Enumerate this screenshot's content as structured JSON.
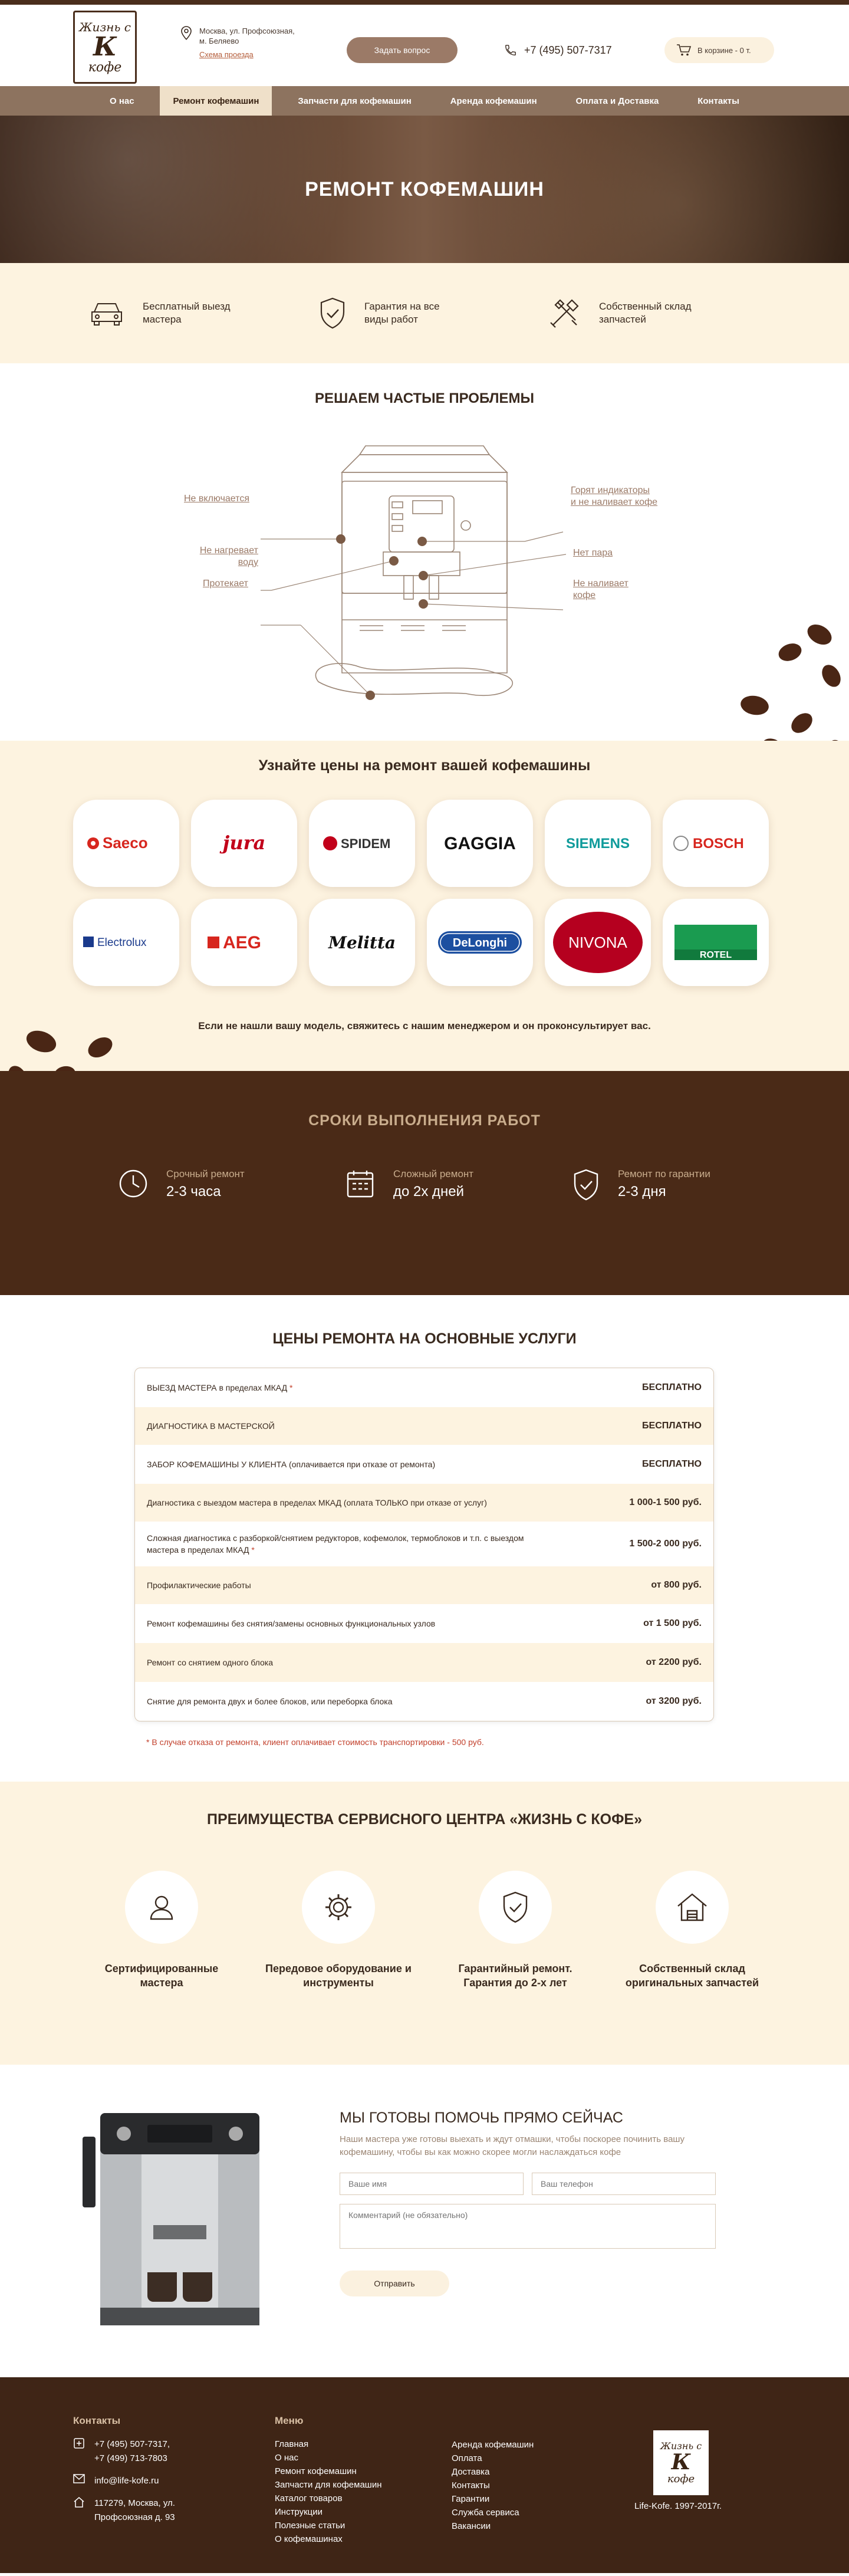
{
  "header": {
    "logo": {
      "line1": "Жизнь с",
      "line2": "К",
      "line3": "кофе"
    },
    "address": [
      "Москва, ул. Профсоюзная,",
      "м. Беляево"
    ],
    "map_link": "Схема проезда",
    "ask_button": "Задать вопрос",
    "phone": "+7 (495) 507-7317",
    "cart": "В корзине - 0 т."
  },
  "nav": [
    "О нас",
    "Ремонт кофемашин",
    "Запчасти для кофемашин",
    "Аренда кофемашин",
    "Оплата и Доставка",
    "Контакты"
  ],
  "hero": {
    "title": "РЕМОНТ КОФЕМАШИН"
  },
  "features": [
    {
      "icon": "car-icon",
      "line1": "Бесплатный выезд",
      "line2": "мастера"
    },
    {
      "icon": "shield-check-icon",
      "line1": "Гарантия на все",
      "line2": "виды работ"
    },
    {
      "icon": "tools-icon",
      "line1": "Собственный склад",
      "line2": "запчастей"
    }
  ],
  "problems": {
    "title": "РЕШАЕМ ЧАСТЫЕ ПРОБЛЕМЫ",
    "left": [
      {
        "line1": "Не включается",
        "line2": ""
      },
      {
        "line1": "Не нагревает",
        "line2": "воду"
      },
      {
        "line1": "Протекает",
        "line2": ""
      }
    ],
    "right": [
      {
        "line1": "Горят индикаторы",
        "line2": "и не наливает кофе"
      },
      {
        "line1": "Нет пара",
        "line2": ""
      },
      {
        "line1": "Не наливает",
        "line2": "кофе"
      }
    ]
  },
  "brands": {
    "title": "Узнайте цены на ремонт вашей кофемашины",
    "items": [
      "Saeco",
      "jura",
      "SPIDEM",
      "GAGGIA",
      "SIEMENS",
      "BOSCH",
      "Electrolux",
      "AEG",
      "Melitta",
      "DeLonghi",
      "NIVONA",
      "ROTEL"
    ],
    "note": "Если не нашли вашу модель, свяжитесь с нашим менеджером и он проконсультирует вас."
  },
  "terms": {
    "title": "СРОКИ ВЫПОЛНЕНИЯ РАБОТ",
    "items": [
      {
        "icon": "clock-icon",
        "label": "Срочный ремонт",
        "value": "2-3 часа"
      },
      {
        "icon": "calendar-icon",
        "label": "Сложный ремонт",
        "value": "до 2х дней"
      },
      {
        "icon": "shield-check-icon",
        "label": "Ремонт по гарантии",
        "value": "2-3 дня"
      }
    ]
  },
  "prices": {
    "title": "ЦЕНЫ РЕМОНТА НА ОСНОВНЫЕ УСЛУГИ",
    "rows": [
      {
        "service": "ВЫЕЗД МАСТЕРА в пределах МКАД",
        "star": "*",
        "price": "БЕСПЛАТНО"
      },
      {
        "service": "ДИАГНОСТИКА В МАСТЕРСКОЙ",
        "star": "",
        "price": "БЕСПЛАТНО"
      },
      {
        "service": "ЗАБОР КОФЕМАШИНЫ У КЛИЕНТА (оплачивается при отказе от ремонта)",
        "star": "",
        "price": "БЕСПЛАТНО"
      },
      {
        "service": "Диагностика с выездом мастера в пределах МКАД (оплата ТОЛЬКО при отказе от услуг)",
        "star": "",
        "price": "1 000-1 500 руб."
      },
      {
        "service": "Сложная диагностика с разборкой/снятием редукторов, кофемолок, термоблоков и т.п. с выездом мастера в пределах МКАД",
        "star": "*",
        "price": "1 500-2 000 руб."
      },
      {
        "service": "Профилактические работы",
        "star": "",
        "price": "от 800 руб."
      },
      {
        "service": "Ремонт кофемашины без снятия/замены основных функциональных узлов",
        "star": "",
        "price": "от 1 500 руб."
      },
      {
        "service": "Ремонт со снятием одного блока",
        "star": "",
        "price": "от 2200 руб."
      },
      {
        "service": "Снятие для ремонта двух и более блоков, или переборка блока",
        "star": "",
        "price": "от 3200 руб."
      }
    ],
    "footnote": "* В случае отказа от ремонта, клиент оплачивает стоимость транспортировки - 500 руб."
  },
  "advantages": {
    "title": "ПРЕИМУЩЕСТВА СЕРВИСНОГО ЦЕНТРА «ЖИЗНЬ С КОФЕ»",
    "items": [
      {
        "icon": "user-icon",
        "line1": "Сертифицированные",
        "line2": "мастера"
      },
      {
        "icon": "gear-icon",
        "line1": "Передовое оборудование и",
        "line2": "инструменты"
      },
      {
        "icon": "shield-check-icon",
        "line1": "Гарантийный ремонт.",
        "line2": "Гарантия до 2-х лет"
      },
      {
        "icon": "house-icon",
        "line1": "Собственный склад",
        "line2": "оригинальных запчастей"
      }
    ]
  },
  "form": {
    "title": "МЫ ГОТОВЫ ПОМОЧЬ ПРЯМО СЕЙЧАС",
    "subtitle": "Наши мастера уже готовы выехать и ждут отмашки, чтобы поскорее починить вашу кофемашину, чтобы вы как можно скорее могли наслаждаться кофе",
    "name_placeholder": "Ваше имя",
    "phone_placeholder": "Ваш телефон",
    "comment_placeholder": "Комментарий (не обязательно)",
    "submit": "Отправить"
  },
  "footer": {
    "contacts_title": "Контакты",
    "phones": [
      "+7 (495) 507-7317,",
      "+7 (499) 713-7803"
    ],
    "email": "info@life-kofe.ru",
    "address": [
      "117279, Москва, ул.",
      "Профсоюзная д. 93"
    ],
    "menu_title": "Меню",
    "menu_col1": [
      "Главная",
      "О нас",
      "Ремонт кофемашин",
      "Запчасти для кофемашин",
      "Каталог товаров",
      "Инструкции",
      "Полезные статьи",
      "О кофемашинах"
    ],
    "menu_col2": [
      "Аренда кофемашин",
      "Оплата",
      "Доставка",
      "Контакты",
      "Гарантии",
      "Служба сервиса",
      "Вакансии"
    ],
    "copyright": "Life-Kofe. 1997-2017г."
  },
  "colors": {
    "brown_dark": "#4a2a17",
    "brown_nav": "#8d735f",
    "cream": "#fdf3e0",
    "accent_red": "#c2402c"
  }
}
